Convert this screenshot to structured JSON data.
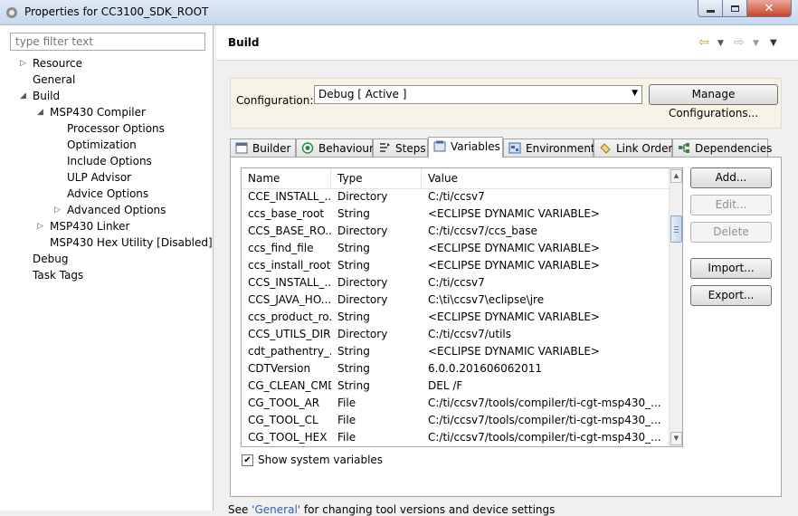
{
  "window": {
    "title": "Properties for CC3100_SDK_ROOT"
  },
  "left": {
    "filter_placeholder": "type filter text",
    "tree": [
      {
        "label": "Resource",
        "level": 1,
        "twisty": "collapsed"
      },
      {
        "label": "General",
        "level": 1,
        "twisty": ""
      },
      {
        "label": "Build",
        "level": 1,
        "twisty": "expanded"
      },
      {
        "label": "MSP430 Compiler",
        "level": 2,
        "twisty": "expanded"
      },
      {
        "label": "Processor Options",
        "level": 3,
        "twisty": ""
      },
      {
        "label": "Optimization",
        "level": 3,
        "twisty": ""
      },
      {
        "label": "Include Options",
        "level": 3,
        "twisty": ""
      },
      {
        "label": "ULP Advisor",
        "level": 3,
        "twisty": ""
      },
      {
        "label": "Advice Options",
        "level": 3,
        "twisty": ""
      },
      {
        "label": "Advanced Options",
        "level": 3,
        "twisty": "collapsed"
      },
      {
        "label": "MSP430 Linker",
        "level": 2,
        "twisty": "collapsed"
      },
      {
        "label": "MSP430 Hex Utility  [Disabled]",
        "level": 2,
        "twisty": ""
      },
      {
        "label": "Debug",
        "level": 1,
        "twisty": ""
      },
      {
        "label": "Task Tags",
        "level": 1,
        "twisty": ""
      }
    ]
  },
  "header": {
    "title": "Build"
  },
  "config": {
    "label": "Configuration:",
    "selected": "Debug  [ Active ]",
    "manage_label": "Manage Configurations..."
  },
  "tabs": [
    {
      "label": "Builder",
      "icon": "builder-icon"
    },
    {
      "label": "Behaviour",
      "icon": "behaviour-icon"
    },
    {
      "label": "Steps",
      "icon": "steps-icon"
    },
    {
      "label": "Variables",
      "icon": "variables-icon",
      "active": true
    },
    {
      "label": "Environment",
      "icon": "environment-icon"
    },
    {
      "label": "Link Order",
      "icon": "link-order-icon"
    },
    {
      "label": "Dependencies",
      "icon": "dependencies-icon"
    }
  ],
  "table": {
    "columns": [
      "Name",
      "Type",
      "Value"
    ],
    "rows": [
      [
        "CCE_INSTALL_...",
        "Directory",
        "C:/ti/ccsv7"
      ],
      [
        "ccs_base_root",
        "String",
        "<ECLIPSE DYNAMIC VARIABLE>"
      ],
      [
        "CCS_BASE_RO...",
        "Directory",
        "C:/ti/ccsv7/ccs_base"
      ],
      [
        "ccs_find_file",
        "String",
        "<ECLIPSE DYNAMIC VARIABLE>"
      ],
      [
        "ccs_install_root",
        "String",
        "<ECLIPSE DYNAMIC VARIABLE>"
      ],
      [
        "CCS_INSTALL_...",
        "Directory",
        "C:/ti/ccsv7"
      ],
      [
        "CCS_JAVA_HO...",
        "Directory",
        "C:\\ti\\ccsv7\\eclipse\\jre"
      ],
      [
        "ccs_product_ro...",
        "String",
        "<ECLIPSE DYNAMIC VARIABLE>"
      ],
      [
        "CCS_UTILS_DIR",
        "Directory",
        "C:/ti/ccsv7/utils"
      ],
      [
        "cdt_pathentry_...",
        "String",
        "<ECLIPSE DYNAMIC VARIABLE>"
      ],
      [
        "CDTVersion",
        "String",
        "6.0.0.201606062011"
      ],
      [
        "CG_CLEAN_CMD",
        "String",
        "DEL /F"
      ],
      [
        "CG_TOOL_AR",
        "File",
        "C:/ti/ccsv7/tools/compiler/ti-cgt-msp430_..."
      ],
      [
        "CG_TOOL_CL",
        "File",
        "C:/ti/ccsv7/tools/compiler/ti-cgt-msp430_..."
      ],
      [
        "CG_TOOL_HEX",
        "File",
        "C:/ti/ccsv7/tools/compiler/ti-cgt-msp430_..."
      ]
    ]
  },
  "buttons": {
    "add": "Add...",
    "edit": "Edit...",
    "delete": "Delete",
    "import": "Import...",
    "export": "Export..."
  },
  "show_system": {
    "label": "Show system variables",
    "checked": true
  },
  "footer": {
    "pre": "See ",
    "link": "'General'",
    "post": " for changing tool versions and device settings"
  }
}
